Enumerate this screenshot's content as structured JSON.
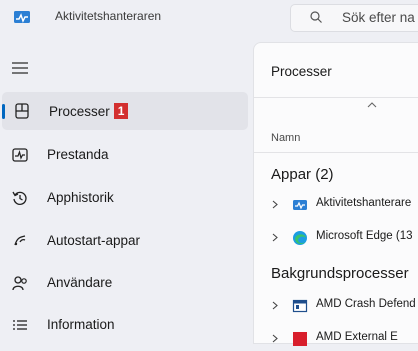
{
  "titlebar": {
    "title": "Aktivitetshanteraren",
    "search_placeholder": "Sök efter na"
  },
  "nav": {
    "items": [
      {
        "label": "Processer",
        "icon": "processes-icon",
        "badge": "1"
      },
      {
        "label": "Prestanda",
        "icon": "performance-icon"
      },
      {
        "label": "Apphistorik",
        "icon": "history-icon"
      },
      {
        "label": "Autostart-appar",
        "icon": "startup-icon"
      },
      {
        "label": "Användare",
        "icon": "users-icon"
      },
      {
        "label": "Information",
        "icon": "details-icon"
      }
    ]
  },
  "main": {
    "title": "Processer",
    "column_name": "Namn",
    "groups": [
      {
        "label": "Appar (2)",
        "rows": [
          {
            "name": "Aktivitetshanterare",
            "icon": "task-manager-icon"
          },
          {
            "name": "Microsoft Edge (13",
            "icon": "edge-icon"
          }
        ]
      },
      {
        "label": "Bakgrundsprocesser",
        "rows": [
          {
            "name": "AMD Crash Defend",
            "icon": "app-window-icon"
          },
          {
            "name": "AMD External E",
            "icon": "amd-icon"
          }
        ]
      }
    ]
  },
  "colors": {
    "accent": "#0067c0",
    "badge": "#d32f2f",
    "background": "#eeeff4"
  }
}
